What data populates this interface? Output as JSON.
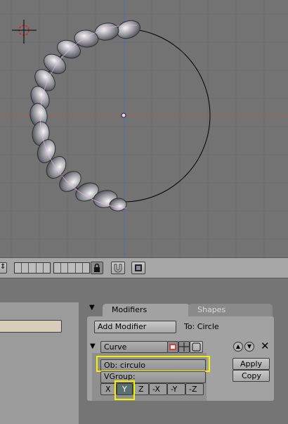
{
  "panels": {
    "tab_modifiers": "Modifiers",
    "tab_shapes": "Shapes"
  },
  "modifiers": {
    "add_modifier_label": "Add Modifier",
    "target_label": "To: Circle",
    "modifier_name": "Curve",
    "object_field": "Ob: circulo",
    "vgroup_field": "VGroup:",
    "apply_label": "Apply",
    "copy_label": "Copy",
    "axis_buttons": [
      "X",
      "Y",
      "Z",
      "-X",
      "-Y",
      "-Z"
    ],
    "selected_axis": "Y"
  },
  "colors": {
    "viewport_bg": "#737373",
    "highlight": "#f2f200"
  }
}
